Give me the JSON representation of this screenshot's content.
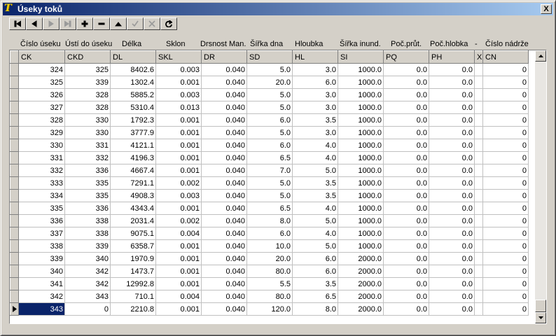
{
  "window": {
    "title": "Úseky toků",
    "close_label": "X"
  },
  "navigator": {
    "buttons": [
      {
        "name": "first",
        "icon": "first-record-icon",
        "enabled": true
      },
      {
        "name": "prior",
        "icon": "prior-record-icon",
        "enabled": true
      },
      {
        "name": "next",
        "icon": "next-record-icon",
        "enabled": false
      },
      {
        "name": "last",
        "icon": "last-record-icon",
        "enabled": false
      },
      {
        "name": "insert",
        "icon": "plus-icon",
        "enabled": true
      },
      {
        "name": "delete",
        "icon": "minus-icon",
        "enabled": true
      },
      {
        "name": "edit",
        "icon": "triangle-up-icon",
        "enabled": true
      },
      {
        "name": "post",
        "icon": "checkmark-icon",
        "enabled": false
      },
      {
        "name": "cancel",
        "icon": "x-icon",
        "enabled": false
      },
      {
        "name": "refresh",
        "icon": "refresh-icon",
        "enabled": true
      }
    ]
  },
  "header_labels": [
    "Číslo úseku",
    "Ústí do úseku",
    "Délka",
    "Sklon",
    "Drsnost Man.",
    "Šířka dna",
    "Hloubka",
    "Šířka inund.",
    "Poč.průt.",
    "Poč.hlobka",
    "-",
    "Číslo nádrže"
  ],
  "grid": {
    "columns": [
      "CK",
      "CKD",
      "DL",
      "SKL",
      "DR",
      "SD",
      "HL",
      "SI",
      "PQ",
      "PH",
      "X",
      "CN"
    ],
    "rows": [
      [
        "324",
        "325",
        "8402.6",
        "0.003",
        "0.040",
        "5.0",
        "3.0",
        "1000.0",
        "0.0",
        "0.0",
        "",
        "0"
      ],
      [
        "325",
        "339",
        "1302.4",
        "0.001",
        "0.040",
        "20.0",
        "6.0",
        "1000.0",
        "0.0",
        "0.0",
        "",
        "0"
      ],
      [
        "326",
        "328",
        "5885.2",
        "0.003",
        "0.040",
        "5.0",
        "3.0",
        "1000.0",
        "0.0",
        "0.0",
        "",
        "0"
      ],
      [
        "327",
        "328",
        "5310.4",
        "0.013",
        "0.040",
        "5.0",
        "3.0",
        "1000.0",
        "0.0",
        "0.0",
        "",
        "0"
      ],
      [
        "328",
        "330",
        "1792.3",
        "0.001",
        "0.040",
        "6.0",
        "3.5",
        "1000.0",
        "0.0",
        "0.0",
        "",
        "0"
      ],
      [
        "329",
        "330",
        "3777.9",
        "0.001",
        "0.040",
        "5.0",
        "3.0",
        "1000.0",
        "0.0",
        "0.0",
        "",
        "0"
      ],
      [
        "330",
        "331",
        "4121.1",
        "0.001",
        "0.040",
        "6.0",
        "4.0",
        "1000.0",
        "0.0",
        "0.0",
        "",
        "0"
      ],
      [
        "331",
        "332",
        "4196.3",
        "0.001",
        "0.040",
        "6.5",
        "4.0",
        "1000.0",
        "0.0",
        "0.0",
        "",
        "0"
      ],
      [
        "332",
        "336",
        "4667.4",
        "0.001",
        "0.040",
        "7.0",
        "5.0",
        "1000.0",
        "0.0",
        "0.0",
        "",
        "0"
      ],
      [
        "333",
        "335",
        "7291.1",
        "0.002",
        "0.040",
        "5.0",
        "3.5",
        "1000.0",
        "0.0",
        "0.0",
        "",
        "0"
      ],
      [
        "334",
        "335",
        "4908.3",
        "0.003",
        "0.040",
        "5.0",
        "3.5",
        "1000.0",
        "0.0",
        "0.0",
        "",
        "0"
      ],
      [
        "335",
        "336",
        "4343.4",
        "0.001",
        "0.040",
        "6.5",
        "4.0",
        "1000.0",
        "0.0",
        "0.0",
        "",
        "0"
      ],
      [
        "336",
        "338",
        "2031.4",
        "0.002",
        "0.040",
        "8.0",
        "5.0",
        "1000.0",
        "0.0",
        "0.0",
        "",
        "0"
      ],
      [
        "337",
        "338",
        "9075.1",
        "0.004",
        "0.040",
        "6.0",
        "4.0",
        "1000.0",
        "0.0",
        "0.0",
        "",
        "0"
      ],
      [
        "338",
        "339",
        "6358.7",
        "0.001",
        "0.040",
        "10.0",
        "5.0",
        "1000.0",
        "0.0",
        "0.0",
        "",
        "0"
      ],
      [
        "339",
        "340",
        "1970.9",
        "0.001",
        "0.040",
        "20.0",
        "6.0",
        "2000.0",
        "0.0",
        "0.0",
        "",
        "0"
      ],
      [
        "340",
        "342",
        "1473.7",
        "0.001",
        "0.040",
        "80.0",
        "6.0",
        "2000.0",
        "0.0",
        "0.0",
        "",
        "0"
      ],
      [
        "341",
        "342",
        "12992.8",
        "0.001",
        "0.040",
        "5.5",
        "3.5",
        "2000.0",
        "0.0",
        "0.0",
        "",
        "0"
      ],
      [
        "342",
        "343",
        "710.1",
        "0.004",
        "0.040",
        "80.0",
        "6.5",
        "2000.0",
        "0.0",
        "0.0",
        "",
        "0"
      ],
      [
        "343",
        "0",
        "2210.8",
        "0.001",
        "0.040",
        "120.0",
        "8.0",
        "2000.0",
        "0.0",
        "0.0",
        "",
        "0"
      ]
    ],
    "selected_row": 19,
    "selected_col": 0
  },
  "colors": {
    "titlebar_start": "#0a246a",
    "titlebar_end": "#a6caf0",
    "selection": "#0a246a",
    "face": "#d4d0c8"
  }
}
